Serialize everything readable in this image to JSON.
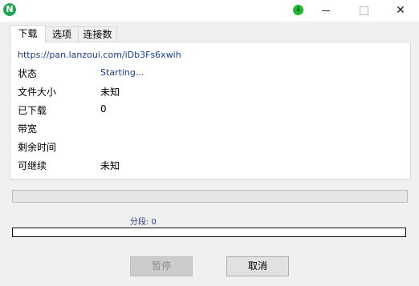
{
  "titlebar": {
    "app_icon_glyph": "N",
    "app_icon_name": "app-logo-icon",
    "download_icon_glyph": "↓",
    "minimize_icon": "minimize-icon",
    "maximize_icon": "maximize-icon",
    "close_glyph": "✕"
  },
  "tabs": [
    {
      "label": "下载",
      "active": true
    },
    {
      "label": "选项",
      "active": false
    },
    {
      "label": "连接数",
      "active": false
    }
  ],
  "download": {
    "url": "https://pan.lanzoui.com/iDb3Fs6xwih",
    "rows": [
      {
        "label": "状态",
        "value": "Starting..."
      },
      {
        "label": "文件大小",
        "value": "未知"
      },
      {
        "label": "已下载",
        "value": "0"
      },
      {
        "label": "带宽",
        "value": ""
      },
      {
        "label": "剩余时间",
        "value": ""
      },
      {
        "label": "可继续",
        "value": "未知"
      }
    ]
  },
  "progress": {
    "main_fraction": 0,
    "segments_text": "分段: 0"
  },
  "buttons": {
    "pause_label": "暂停",
    "cancel_label": "取消"
  },
  "colors": {
    "accent_text": "#1a3c8c",
    "app_icon": "#21a650",
    "download_icon": "#1fb832"
  }
}
